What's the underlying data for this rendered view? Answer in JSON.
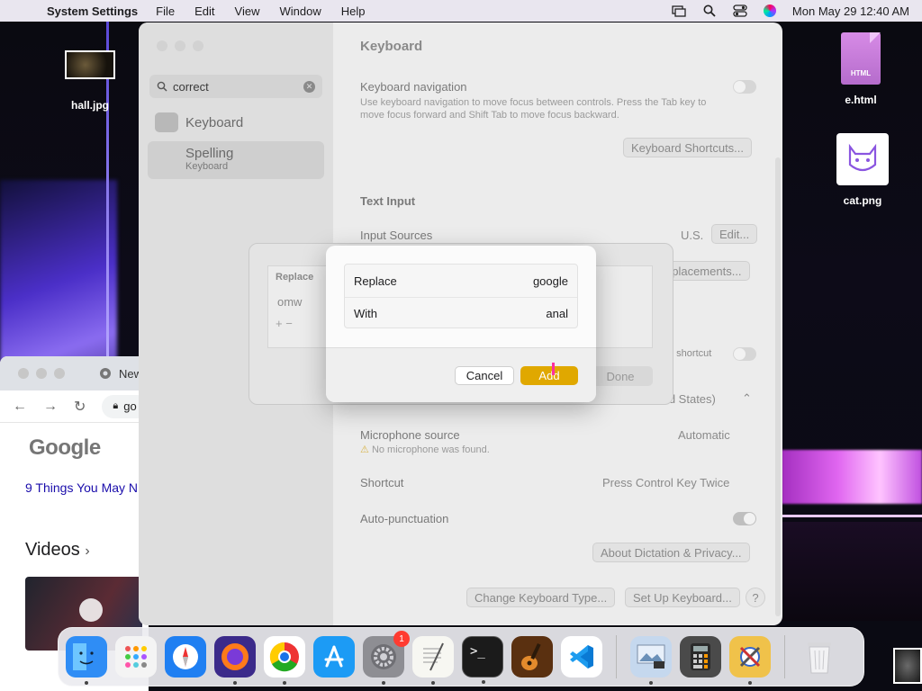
{
  "menubar": {
    "app_name": "System Settings",
    "items": [
      "File",
      "Edit",
      "View",
      "Window",
      "Help"
    ],
    "clock": "Mon May 29  12:40 AM"
  },
  "desktop": {
    "icons": [
      {
        "label": "hall.jpg"
      },
      {
        "label": "e.html",
        "badge_text": "HTML"
      },
      {
        "label": "cat.png"
      }
    ]
  },
  "chrome": {
    "tab_title": "New",
    "url_text": "go",
    "logo": "Google",
    "link_text": "9 Things You May N",
    "section": "Videos"
  },
  "settings": {
    "search": {
      "value": "correct"
    },
    "sidebar": {
      "item": "Keyboard",
      "selected": {
        "title": "Spelling",
        "subtitle": "Keyboard"
      }
    },
    "title": "Keyboard",
    "keyboard_navigation": {
      "label": "Keyboard navigation",
      "description": "Use keyboard navigation to move focus between controls. Press the Tab key to move focus forward and Shift Tab to move focus backward."
    },
    "keyboard_shortcuts_button": "Keyboard Shortcuts...",
    "text_input_header": "Text Input",
    "input_sources": {
      "label": "Input Sources",
      "value": "U.S.",
      "button": "Edit..."
    },
    "replacements_button": "eplacements...",
    "shortcut_hint": "e shortcut",
    "language_value": "ted States)",
    "microphone": {
      "label": "Microphone source",
      "warning": "No microphone was found.",
      "value": "Automatic"
    },
    "shortcut": {
      "label": "Shortcut",
      "value": "Press Control Key Twice"
    },
    "auto_punctuation": {
      "label": "Auto-punctuation"
    },
    "about_dictation_button": "About Dictation & Privacy...",
    "change_keyboard_button": "Change Keyboard Type...",
    "setup_keyboard_button": "Set Up Keyboard...",
    "help_label": "?"
  },
  "replacements_sheet": {
    "column_header": "Replace",
    "row_value": "omw",
    "add_remove": "+   −",
    "done_button": "Done"
  },
  "dialog": {
    "replace_label": "Replace",
    "replace_value": "google",
    "with_label": "With",
    "with_value": "anal",
    "cancel_button": "Cancel",
    "add_button": "Add"
  },
  "dock": {
    "apps": [
      {
        "name": "Finder",
        "icon": "finder-icon",
        "color": "#2f8df5"
      },
      {
        "name": "Launchpad",
        "icon": "launchpad-icon",
        "color": "#f4f4f4"
      },
      {
        "name": "Safari",
        "icon": "safari-icon",
        "color": "#1f7ff2"
      },
      {
        "name": "Firefox",
        "icon": "firefox-icon",
        "color": "#ff7a1a"
      },
      {
        "name": "Chrome",
        "icon": "chrome-icon",
        "color": "#ffffff"
      },
      {
        "name": "App Store",
        "icon": "app-store-icon",
        "color": "#1c9bf5"
      },
      {
        "name": "System Settings",
        "icon": "gear-icon",
        "color": "#8e8e93",
        "badge": "1"
      },
      {
        "name": "TextEdit",
        "icon": "textedit-icon",
        "color": "#f7f7f2"
      },
      {
        "name": "Terminal",
        "icon": "terminal-icon",
        "color": "#1b1b1b"
      },
      {
        "name": "GarageBand",
        "icon": "guitar-icon",
        "color": "#e38a2c"
      },
      {
        "name": "VS Code",
        "icon": "vscode-icon",
        "color": "#ffffff"
      },
      {
        "name": "Preview",
        "icon": "preview-icon",
        "color": "#c5d8ee"
      },
      {
        "name": "Calculator",
        "icon": "calculator-icon",
        "color": "#4a4a4a"
      },
      {
        "name": "Xcode Tools",
        "icon": "tools-icon",
        "color": "#f0c24a"
      },
      {
        "name": "Trash",
        "icon": "trash-icon",
        "color": "#e4e4e6"
      }
    ]
  }
}
